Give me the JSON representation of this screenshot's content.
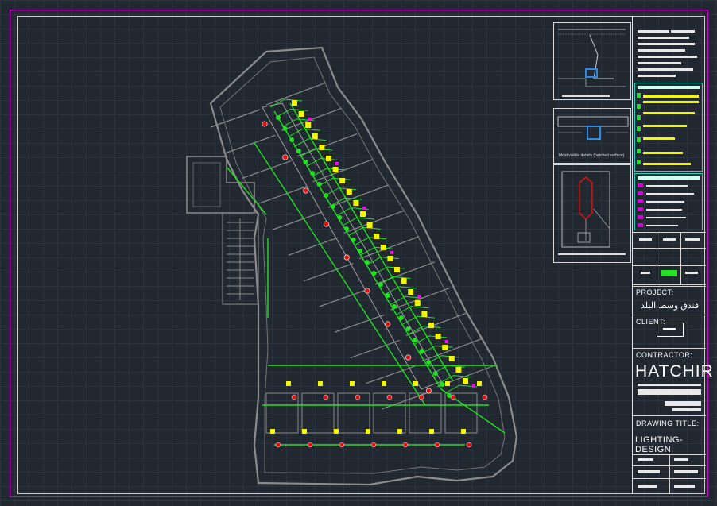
{
  "title_block": {
    "project_label": "PROJECT:",
    "project_name_ar": "فندق وسط البلد",
    "client_label": "CLIENT:",
    "contractor_label": "CONTRACTOR:",
    "contractor_name": "HATCHIR",
    "drawing_title_label": "DRAWING TITLE:",
    "drawing_title": "LIGHTING-DESIGN"
  },
  "detail_captions": {
    "detail_2": "Most visible details (hatched surface)"
  },
  "colors": {
    "sheet_border": "#d400d4",
    "background": "#212830",
    "circuit_green": "#22e022",
    "fixture_yellow": "#f2f600",
    "accent_magenta": "#ff00ff",
    "marker_red": "#e01010",
    "wall_gray": "#8c8c8c"
  },
  "icons": {
    "client_icon": "client-logo-rectangle-icon"
  }
}
